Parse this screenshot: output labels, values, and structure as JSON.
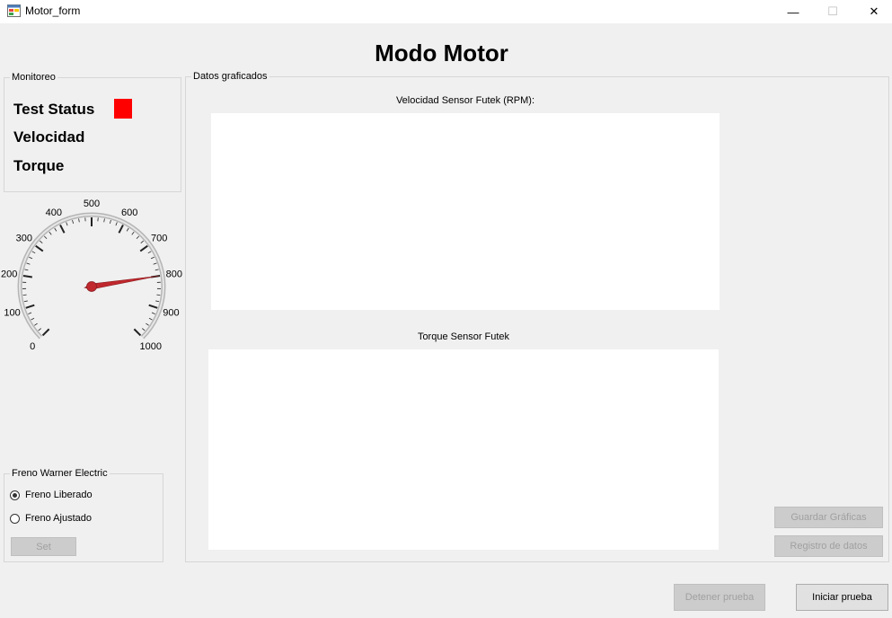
{
  "window": {
    "title": "Motor_form",
    "min_glyph": "—",
    "max_glyph": "☐",
    "close_glyph": "✕"
  },
  "page": {
    "title": "Modo Motor"
  },
  "monitoreo": {
    "legend": "Monitoreo",
    "test_status_label": "Test Status",
    "velocidad_label": "Velocidad",
    "torque_label": "Torque",
    "status_color": "#ff0000"
  },
  "gauge": {
    "min": 0,
    "max": 1000,
    "value": 800,
    "tick_labels": [
      "0",
      "100",
      "200",
      "300",
      "400",
      "500",
      "600",
      "700",
      "800",
      "900",
      "1000"
    ],
    "needle_color": "#c0282d"
  },
  "datos": {
    "legend": "Datos graficados",
    "chart1_title": "Velocidad Sensor Futek (RPM):",
    "chart2_title": "Torque Sensor Futek"
  },
  "freno": {
    "legend": "Freno Warner Electric",
    "option1": "Freno Liberado",
    "option2": "Freno Ajustado",
    "selected": "Freno Liberado",
    "set_label": "Set"
  },
  "buttons": {
    "guardar": "Guardar Gráficas",
    "registro": "Registro de datos",
    "detener": "Detener prueba",
    "iniciar": "Iniciar prueba"
  }
}
